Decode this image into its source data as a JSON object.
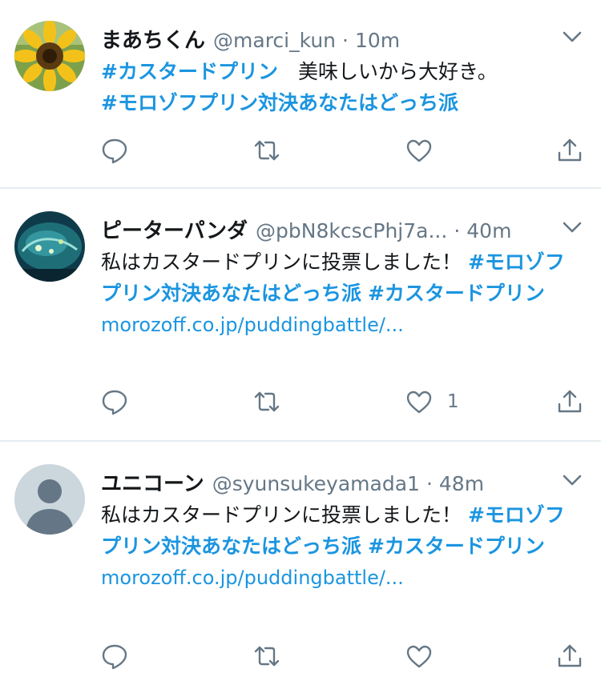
{
  "tweets": [
    {
      "name": "まあちくん",
      "handle": "@marci_kun",
      "separator": "·",
      "time": "10m",
      "text": {
        "tag1": "#カスタードプリン",
        "plain1": "　美味しいから大好き。",
        "tag2": "#モロゾフプリン対決あなたはどっち派"
      },
      "like_count": ""
    },
    {
      "name": "ピーターパンダ",
      "handle": "@pbN8kcscPhj7a...",
      "separator": "·",
      "time": "40m",
      "text": {
        "plain1": "私はカスタードプリンに投票しました！ ",
        "tag1": "#モロゾフプリン対決あなたはどっち派",
        "plain2": " ",
        "tag2": "#カスタードプリン",
        "link": "morozoff.co.jp/puddingbattle/..."
      },
      "like_count": "1"
    },
    {
      "name": "ユニコーン",
      "handle": "@syunsukeyamada1",
      "separator": "·",
      "time": "48m",
      "text": {
        "plain1": "私はカスタードプリンに投票しました！ ",
        "tag1": "#モロゾフプリン対決あなたはどっち派",
        "plain2": " ",
        "tag2": "#カスタードプリン",
        "link": "morozoff.co.jp/puddingbattle/..."
      },
      "like_count": ""
    }
  ],
  "icons": {
    "reply": "reply-icon",
    "retweet": "retweet-icon",
    "like": "heart-icon",
    "share": "share-icon",
    "more": "chevron-down-icon"
  },
  "colors": {
    "hashtag": "#1b95e0",
    "secondary_text": "#657786",
    "icon": "#657786",
    "divider": "#e6ecf0"
  }
}
